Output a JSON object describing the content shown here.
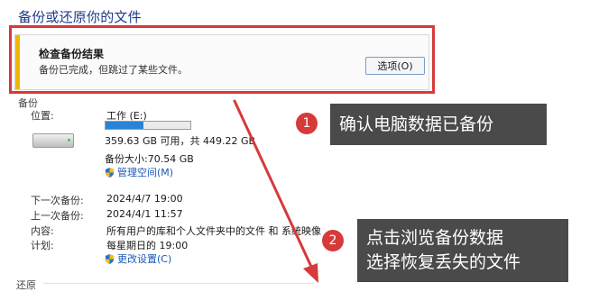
{
  "title": "备份或还原你的文件",
  "notice": {
    "heading": "检查备份结果",
    "message": "备份已完成，但跳过了某些文件。",
    "options_button": "选项(O)"
  },
  "backup": {
    "section_label": "备份",
    "location_label": "位置:",
    "location_value": "工作 (E:)",
    "usage_fraction": 0.45,
    "space_text": "359.63 GB 可用，共 449.22 GB",
    "size_text": "备份大小:70.54 GB",
    "manage_space_link": "管理空间(M)",
    "next_label": "下一次备份:",
    "next_value": "2024/4/7 19:00",
    "last_label": "上一次备份:",
    "last_value": "2024/4/1 11:57",
    "content_label": "内容:",
    "content_value": "所有用户的库和个人文件夹中的文件 和 系统映像",
    "schedule_label": "计划:",
    "schedule_value": "每星期日的 19:00",
    "change_settings_link": "更改设置(C)"
  },
  "restore_label": "还原",
  "steps": [
    {
      "number": "1",
      "text": "确认电脑数据已备份"
    },
    {
      "number": "2",
      "text_line1": "点击浏览备份数据",
      "text_line2": "选择恢复丢失的文件"
    }
  ],
  "colors": {
    "highlight": "#d63a3a",
    "callout_bg": "#4a4a4a",
    "warning_stripe": "#f2b705",
    "link": "#1b57b8",
    "bar_fill": "#2a84d6"
  },
  "icons": [
    "hard-drive-icon",
    "shield-icon",
    "arrow-icon"
  ]
}
